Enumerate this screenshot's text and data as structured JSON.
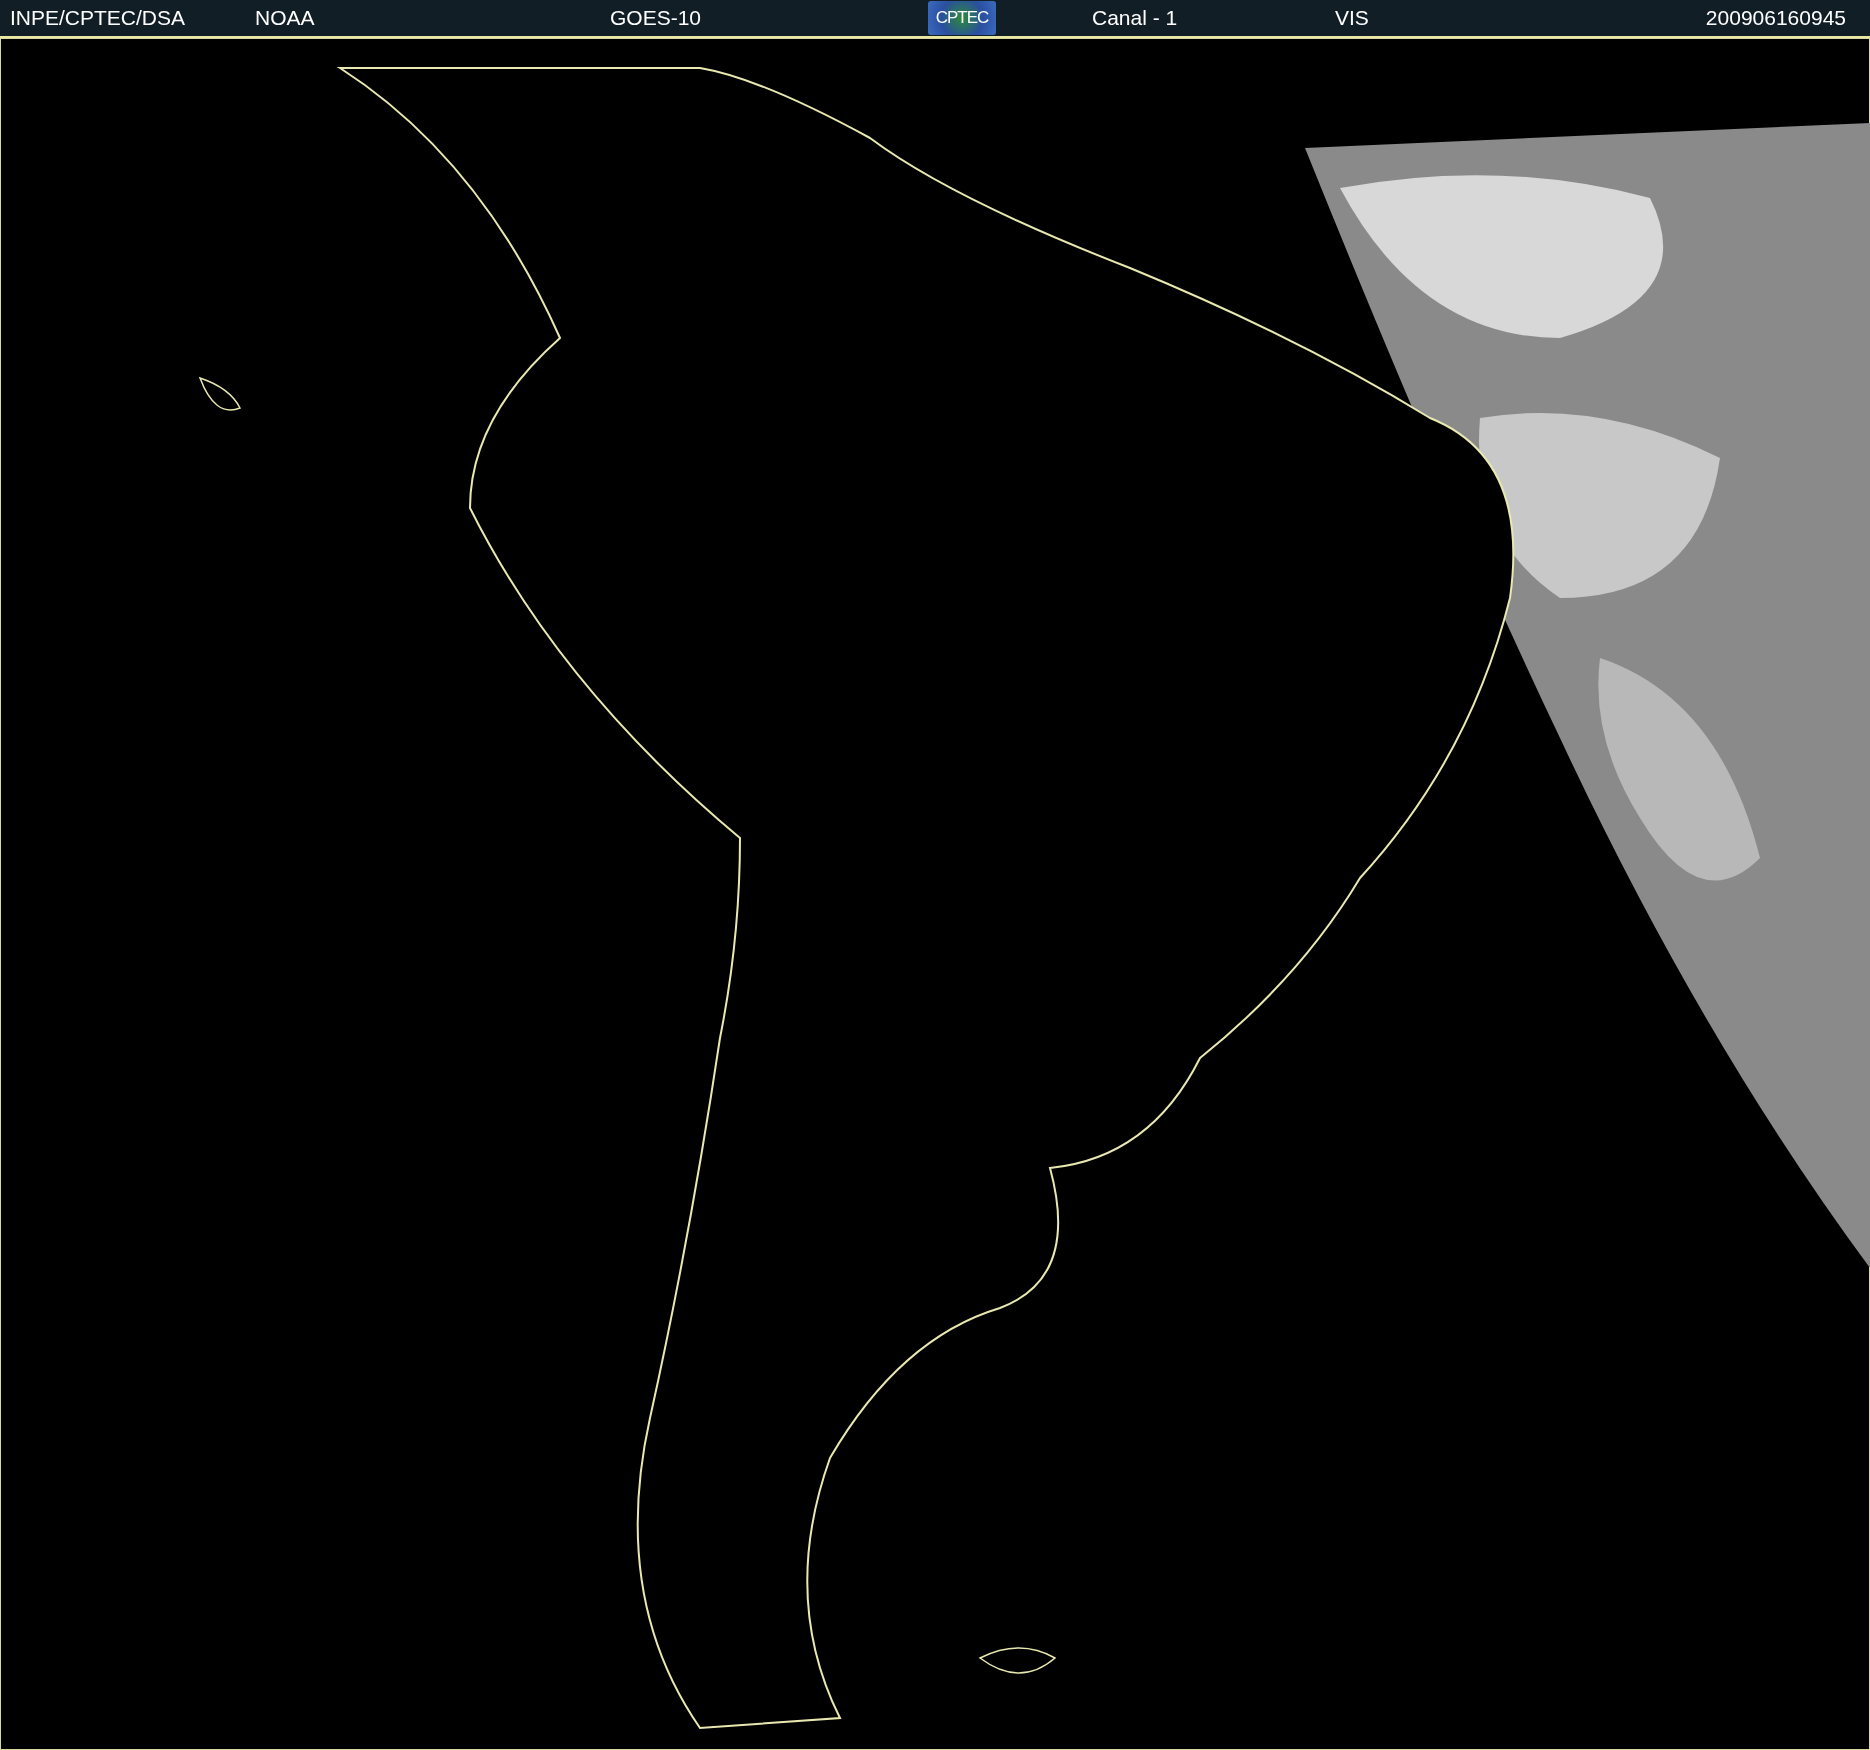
{
  "header": {
    "source": "INPE/CPTEC/DSA",
    "agency": "NOAA",
    "satellite": "GOES-10",
    "logo": "CPTEC",
    "channel": "Canal - 1",
    "band": "VIS",
    "timestamp": "200906160945"
  }
}
